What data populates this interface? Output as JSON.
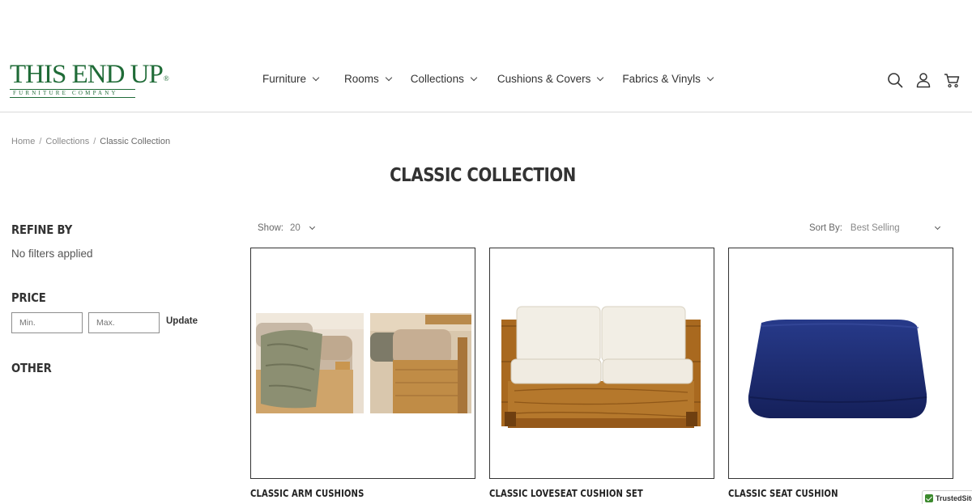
{
  "brand": {
    "logo_main": "THIS END UP",
    "logo_registered": "®",
    "logo_sub": "FURNITURE COMPANY",
    "color": "#1f6b37"
  },
  "nav": {
    "items": [
      {
        "label": "Furniture"
      },
      {
        "label": "Rooms"
      },
      {
        "label": "Collections"
      },
      {
        "label": "Cushions & Covers"
      },
      {
        "label": "Fabrics & Vinyls"
      }
    ]
  },
  "header_icons": [
    "search-icon",
    "account-icon",
    "cart-icon"
  ],
  "breadcrumb": {
    "items": [
      "Home",
      "Collections",
      "Classic Collection"
    ],
    "separator": "/"
  },
  "page": {
    "title": "CLASSIC COLLECTION"
  },
  "sidebar": {
    "refine_heading": "REFINE BY",
    "no_filters": "No filters applied",
    "price_heading": "PRICE",
    "min_placeholder": "Min.",
    "max_placeholder": "Max.",
    "update_label": "Update",
    "other_heading": "OTHER"
  },
  "toolbar": {
    "show_label": "Show:",
    "show_value": "20",
    "sort_label": "Sort By:",
    "sort_value": "Best Selling"
  },
  "products": [
    {
      "title": "CLASSIC ARM CUSHIONS"
    },
    {
      "title": "CLASSIC LOVESEAT CUSHION SET"
    },
    {
      "title": "CLASSIC SEAT CUSHION"
    }
  ],
  "trusted_badge": {
    "label": "TrustedSite"
  },
  "colors": {
    "brand_green": "#1f6b37",
    "text": "#333333",
    "cushion_navy": "#1c2a6b",
    "wood": "#a9691f",
    "cushion_cream": "#f1ede4"
  }
}
